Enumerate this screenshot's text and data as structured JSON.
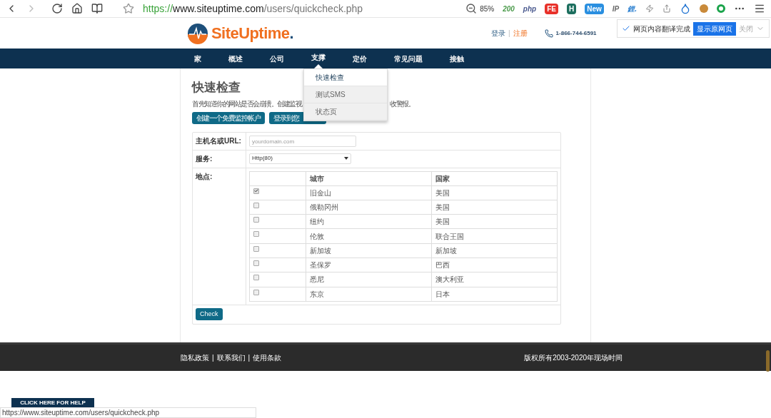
{
  "browser": {
    "url_scheme": "https://",
    "url_host": "www.siteuptime.com",
    "url_path": "/users/quickcheck.php",
    "zoom": "85%",
    "extensions": [
      {
        "kind": "text",
        "label": "200",
        "color": "#4a9a4a"
      },
      {
        "kind": "text",
        "label": "php",
        "color": "#4b5a8f"
      },
      {
        "kind": "badge",
        "label": "FE",
        "color": "#e8312a"
      },
      {
        "kind": "badge",
        "label": "H",
        "color": "#1d6f5f"
      },
      {
        "kind": "badge",
        "label": "New",
        "color": "#2a8fe0"
      },
      {
        "kind": "text",
        "label": "IP",
        "color": "#666666"
      },
      {
        "kind": "text",
        "label": "鋰.",
        "color": "#2a7fd0"
      }
    ]
  },
  "translate_bar": {
    "message": "网页内容翻译完成",
    "button": "显示原网页",
    "close": "关闭"
  },
  "header": {
    "logo": "SiteUptime",
    "logo_suffix": ".",
    "login": "登录",
    "separator": "|",
    "register": "注册",
    "phone": "1-866-744-6591"
  },
  "nav": [
    {
      "label": "家",
      "selected": false
    },
    {
      "label": "概述",
      "selected": false
    },
    {
      "label": "公司",
      "selected": false
    },
    {
      "label": "支撑",
      "selected": true
    },
    {
      "label": "定价",
      "selected": false
    },
    {
      "label": "常见问题",
      "selected": false
    },
    {
      "label": "接触",
      "selected": false
    }
  ],
  "dropdown": [
    {
      "label": "快速检查",
      "selected": true
    },
    {
      "label": "测试SMS",
      "selected": false
    },
    {
      "label": "状态页",
      "selected": false
    }
  ],
  "page": {
    "title": "快速检查",
    "intro_left": "首先知道你的网站是否会崩溃。创建监视",
    "intro_right": "收警报。",
    "buttons": [
      "创建一个免费监控帐户",
      "登录到您"
    ]
  },
  "form": {
    "host_label": "主机名或URL:",
    "host_placeholder": "yourdomain.com",
    "service_label": "服务:",
    "service_value": "Http(80)",
    "location_label": "地点:",
    "columns": [
      "城市",
      "国家"
    ],
    "locations": [
      {
        "city": "旧金山",
        "country": "美国",
        "checked": true
      },
      {
        "city": "俄勒冈州",
        "country": "美国",
        "checked": false
      },
      {
        "city": "纽约",
        "country": "美国",
        "checked": false
      },
      {
        "city": "伦敦",
        "country": "联合王国",
        "checked": false
      },
      {
        "city": "新加坡",
        "country": "新加坡",
        "checked": false
      },
      {
        "city": "圣保罗",
        "country": "巴西",
        "checked": false
      },
      {
        "city": "悉尼",
        "country": "澳大利亚",
        "checked": false
      },
      {
        "city": "东京",
        "country": "日本",
        "checked": false
      }
    ],
    "check_button": "Check"
  },
  "footer": {
    "links": [
      "隐私政策",
      "联系我们",
      "使用条款"
    ],
    "separator": "|",
    "copyright": "版权所有2003-2020年现场时间"
  },
  "help_button": "CLICK HERE FOR HELP",
  "status_url": "https://www.siteuptime.com/users/quickcheck.php"
}
